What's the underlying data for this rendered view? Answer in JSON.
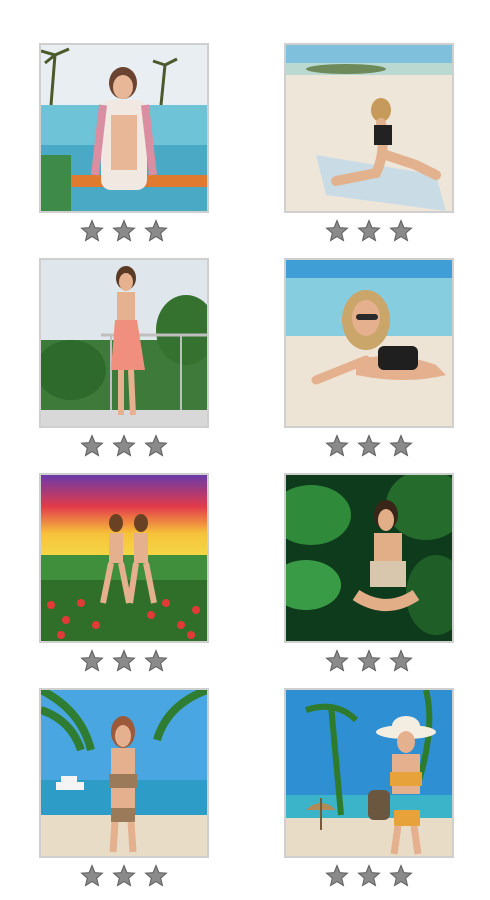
{
  "gallery": {
    "items": [
      {
        "scene": "poolside-resort",
        "rating": 3,
        "max_rating": 3
      },
      {
        "scene": "sandy-beach-towel",
        "rating": 3,
        "max_rating": 3
      },
      {
        "scene": "balcony-palms",
        "rating": 3,
        "max_rating": 3
      },
      {
        "scene": "beach-lying",
        "rating": 3,
        "max_rating": 3
      },
      {
        "scene": "sunset-flower-field",
        "rating": 3,
        "max_rating": 3
      },
      {
        "scene": "tropical-leaves",
        "rating": 3,
        "max_rating": 3
      },
      {
        "scene": "palm-beach-boat",
        "rating": 3,
        "max_rating": 3
      },
      {
        "scene": "beach-sunhat-umbrella",
        "rating": 3,
        "max_rating": 3
      }
    ],
    "icons": {
      "star": "star-icon"
    },
    "colors": {
      "star_fill": "#8a8a8a",
      "star_edge": "#5f5f5f",
      "thumb_border": "#cfcfcf"
    }
  }
}
